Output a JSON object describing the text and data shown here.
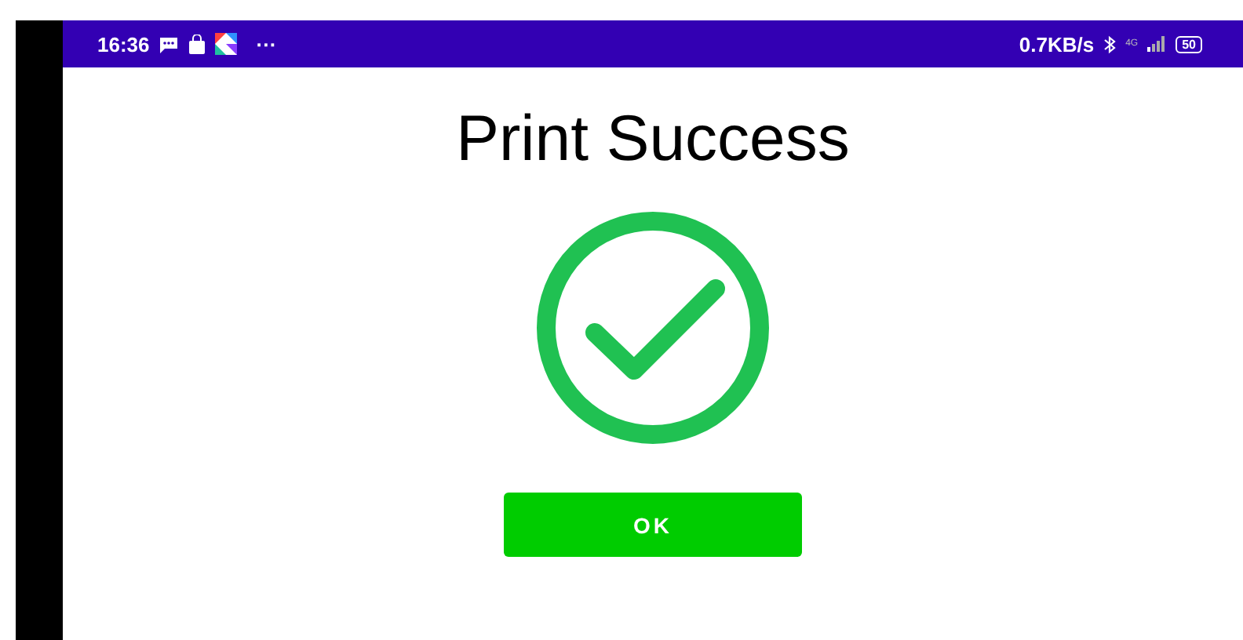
{
  "status_bar": {
    "time": "16:36",
    "more": "···",
    "speed": "0.7KB/s",
    "network": "4G",
    "battery": "50"
  },
  "title": "Print Success",
  "buttons": [
    {
      "label": "OK",
      "kind": "primary"
    }
  ]
}
